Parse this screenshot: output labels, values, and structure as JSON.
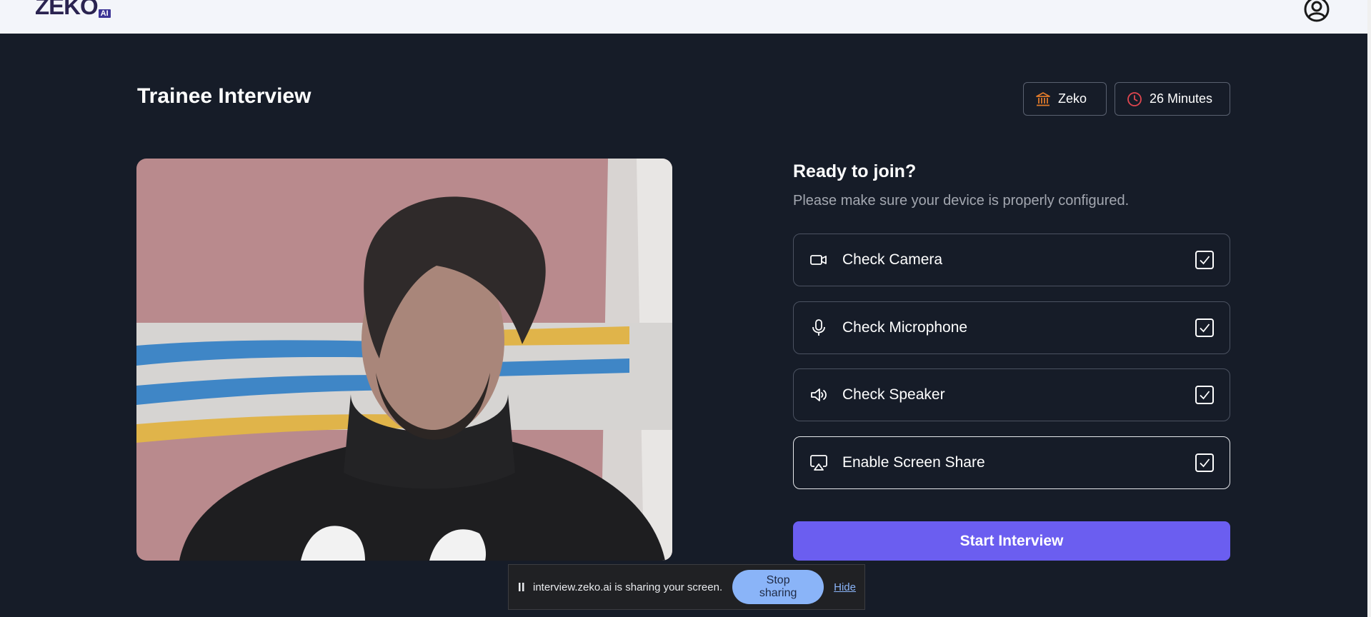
{
  "app": {
    "logo_text": "ZEKO",
    "logo_badge": "AI"
  },
  "header": {
    "title": "Trainee Interview",
    "organization": "Zeko",
    "duration": "26 Minutes"
  },
  "join": {
    "title": "Ready to join?",
    "subtitle": "Please make sure your device is properly configured.",
    "checks": [
      {
        "label": "Check Camera",
        "icon": "camera-icon",
        "checked": true
      },
      {
        "label": "Check Microphone",
        "icon": "microphone-icon",
        "checked": true
      },
      {
        "label": "Check Speaker",
        "icon": "speaker-icon",
        "checked": true
      },
      {
        "label": "Enable Screen Share",
        "icon": "screen-share-icon",
        "checked": true
      }
    ],
    "start_label": "Start Interview"
  },
  "share_bar": {
    "message": "interview.zeko.ai is sharing your screen.",
    "stop_label": "Stop sharing",
    "hide_label": "Hide"
  },
  "colors": {
    "background": "#161c28",
    "primary": "#6b5ef0",
    "org_icon": "#e07a2a",
    "clock_icon": "#e0464f",
    "share_accent": "#8ab4f8"
  }
}
